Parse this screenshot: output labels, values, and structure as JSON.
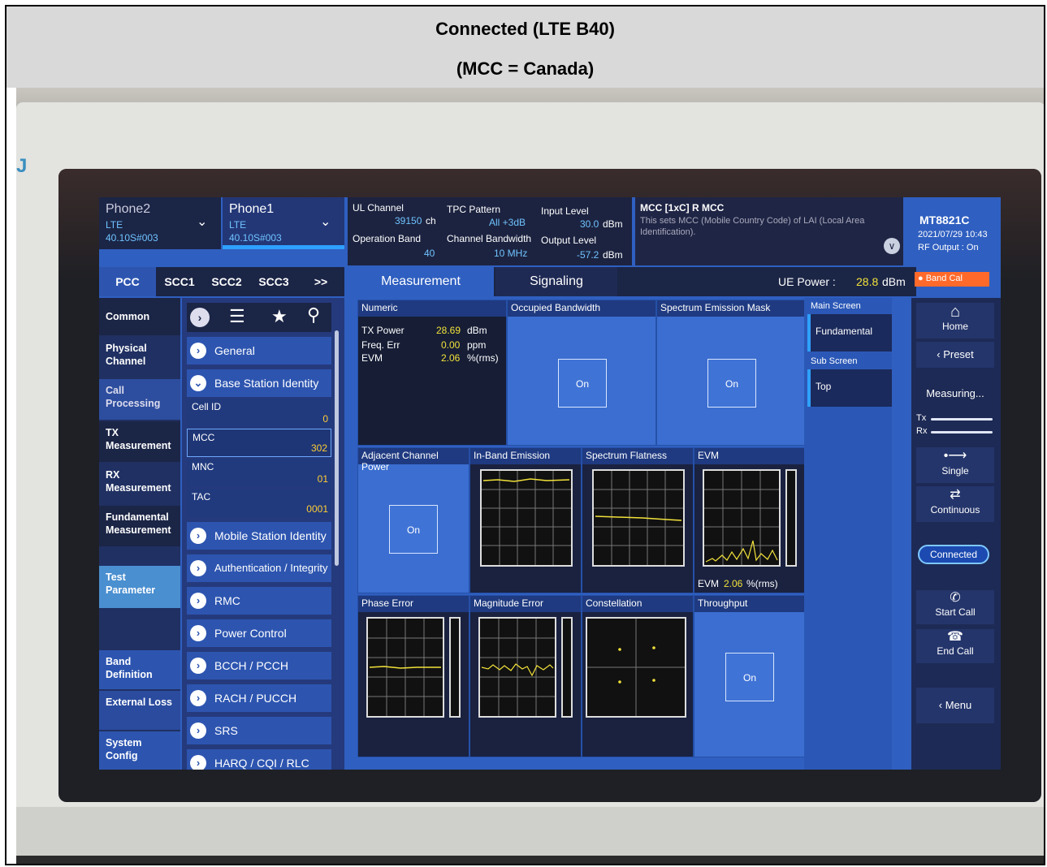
{
  "header": {
    "line1": "Connected (LTE B40)",
    "line2": "(MCC = Canada)"
  },
  "phones": [
    {
      "name": "Phone2",
      "tech": "LTE",
      "version": "40.10S#003"
    },
    {
      "name": "Phone1",
      "tech": "LTE",
      "version": "40.10S#003"
    }
  ],
  "info": {
    "ul_channel_label": "UL Channel",
    "ul_channel_value": "39150",
    "ul_channel_unit": "ch",
    "tpc_label": "TPC Pattern",
    "tpc_value": "All +3dB",
    "input_level_label": "Input Level",
    "input_level_value": "30.0",
    "input_level_unit": "dBm",
    "band_label": "Operation Band",
    "band_value": "40",
    "bw_label": "Channel Bandwidth",
    "bw_value": "10 MHz",
    "output_level_label": "Output Level",
    "output_level_value": "-57.2",
    "output_level_unit": "dBm"
  },
  "mcc_info": {
    "title": "MCC [1xC] R MCC",
    "desc": "This sets MCC (Mobile Country Code) of LAI (Local Area Identification)."
  },
  "brand": {
    "model": "MT8821C",
    "datetime": "2021/07/29 10:43",
    "rf": "RF Output : On"
  },
  "cc_tabs": [
    "PCC",
    "SCC1",
    "SCC2",
    "SCC3",
    ">>"
  ],
  "main_tabs": {
    "measurement": "Measurement",
    "signaling": "Signaling"
  },
  "ue_power": {
    "label": "UE Power :",
    "value": "28.8",
    "unit": "dBm"
  },
  "band_cal": "Band Cal",
  "left_nav": [
    "Common",
    "Physical Channel",
    "Call Processing",
    "TX Measurement",
    "RX Measurement",
    "Fundamental Measurement",
    "Test Parameter",
    "Band Definition",
    "External Loss",
    "System Config"
  ],
  "params": {
    "general": "General",
    "bsi": "Base Station Identity",
    "cell_id_label": "Cell ID",
    "cell_id_value": "0",
    "mcc_label": "MCC",
    "mcc_value": "302",
    "mnc_label": "MNC",
    "mnc_value": "01",
    "tac_label": "TAC",
    "tac_value": "0001",
    "items": [
      "Mobile Station Identity",
      "Authentication / Integrity",
      "RMC",
      "Power Control",
      "BCCH / PCCH",
      "RACH / PUCCH",
      "SRS",
      "HARQ / CQI / RLC"
    ]
  },
  "numeric": {
    "title": "Numeric",
    "rows": [
      {
        "label": "TX Power",
        "value": "28.69",
        "unit": "dBm"
      },
      {
        "label": "Freq. Err",
        "value": "0.00",
        "unit": "ppm"
      },
      {
        "label": "EVM",
        "value": "2.06",
        "unit": "%(rms)"
      }
    ]
  },
  "cells": {
    "obw": "Occupied Bandwidth",
    "sem": "Spectrum Emission Mask",
    "acp": "Adjacent Channel Power",
    "ibe": "In-Band Emission",
    "sf": "Spectrum Flatness",
    "evm": "EVM",
    "evm_readout_label": "EVM",
    "evm_readout_value": "2.06",
    "evm_readout_unit": "%(rms)",
    "phase": "Phase Error",
    "mag": "Magnitude Error",
    "const": "Constellation",
    "thr": "Throughput",
    "on": "On"
  },
  "screen_panel": {
    "main": "Main Screen",
    "fundamental": "Fundamental",
    "sub": "Sub Screen",
    "top": "Top"
  },
  "right": {
    "home": "Home",
    "preset": "Preset",
    "measuring": "Measuring...",
    "tx": "Tx",
    "rx": "Rx",
    "single": "Single",
    "continuous": "Continuous",
    "connected": "Connected",
    "start_call": "Start Call",
    "end_call": "End Call",
    "menu": "Menu"
  },
  "colors": {
    "accent": "#2ea0ff",
    "trace": "#f2e23a",
    "band_cal": "#ff6a2b",
    "screen": "#2f5fc0"
  }
}
